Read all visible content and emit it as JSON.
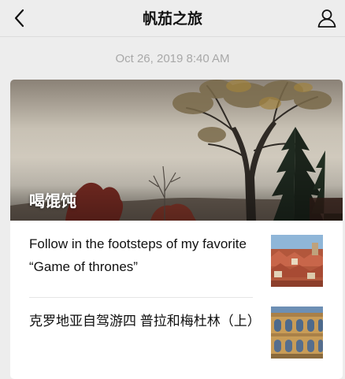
{
  "header": {
    "title": "帆茄之旅",
    "back_icon": "chevron-left-icon",
    "profile_icon": "person-icon"
  },
  "timestamp": "Oct 26, 2019 8:40 AM",
  "card": {
    "cover": {
      "headline": "喝馄饨",
      "image": "autumn-trees-photo"
    },
    "articles": [
      {
        "title": "Follow in the footsteps of my favorite “Game of thrones”",
        "thumbnail": "red-roof-old-town-photo"
      },
      {
        "title": "克罗地亚自驾游四  普拉和梅杜林（上）",
        "thumbnail": "roman-arena-photo"
      }
    ]
  },
  "colors": {
    "background": "#ededed",
    "card": "#ffffff",
    "timestamp": "#a8a8a8"
  }
}
